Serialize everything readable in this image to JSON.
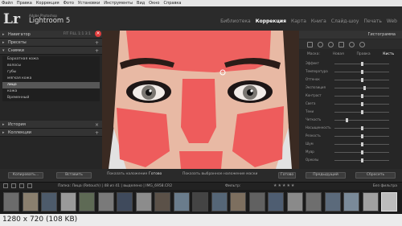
{
  "menu": [
    "Файл",
    "Правка",
    "Коррекция",
    "Фото",
    "Установки",
    "Инструменты",
    "Вид",
    "Окно",
    "Справка"
  ],
  "header": {
    "logo": "Lr",
    "brand_small": "Adobe Photoshop",
    "brand_title": "Lightroom 5",
    "modules": [
      "Библиотека",
      "Коррекция",
      "Карта",
      "Книга",
      "Слайд-шоу",
      "Печать",
      "Web"
    ],
    "active_module": "Коррекция"
  },
  "left": {
    "navigator": {
      "label": "Навигатор",
      "options": "FIT  FILL  1:1  3:1"
    },
    "presets": {
      "label": "Пресеты"
    },
    "snapshots": {
      "label": "Снимки"
    },
    "snapshot_items": [
      "Бархатная кожа",
      "волосы",
      "губы",
      "мягкая кожа",
      "лицо",
      "кожа",
      "Временный"
    ],
    "selected_index": 4,
    "history": {
      "label": "История"
    },
    "collections": {
      "label": "Коллекции"
    },
    "copy_button": "Копировать...",
    "paste_button": "Вставить"
  },
  "center": {
    "show_mask": "Показать наложение",
    "done": "Готово",
    "auto_mask": "Показать выбранное наложение маски",
    "done_button": "Готово"
  },
  "right": {
    "histogram": "Гистограмма",
    "tabs": [
      "Маска:",
      "Новая",
      "Правка",
      "Кисть"
    ],
    "active_tab": "Кисть",
    "sliders": [
      {
        "name": "Эффект",
        "value": 0.5
      },
      {
        "name": "Температура",
        "value": 0.5
      },
      {
        "name": "Оттенок",
        "value": 0.5
      },
      {
        "name": "Экспозиция",
        "value": 0.55
      },
      {
        "name": "Контраст",
        "value": 0.5
      },
      {
        "name": "Света",
        "value": 0.5
      },
      {
        "name": "Тени",
        "value": 0.5
      },
      {
        "name": "Четкость",
        "value": 0.22
      },
      {
        "name": "Насыщенность",
        "value": 0.5
      },
      {
        "name": "Резкость",
        "value": 0.5
      },
      {
        "name": "Шум",
        "value": 0.5
      },
      {
        "name": "Муар",
        "value": 0.5
      },
      {
        "name": "Ореолы",
        "value": 0.5
      }
    ],
    "prev_button": "Предыдущий",
    "reset_button": "Сбросить"
  },
  "filmstrip": {
    "path": "Папка: Лица (Retouch) | 48 из 41 | выделено | IMG_6958.CR2",
    "filter_label": "Фильтр:",
    "filter_value": "Без фильтра",
    "thumbnail_count": 21,
    "selected_thumbnail": 20
  },
  "info": {
    "text": "1280 x 720 (108 KB)"
  },
  "colors": {
    "accent": "#e8e8e8",
    "mask_red": "#ee5c5c"
  }
}
